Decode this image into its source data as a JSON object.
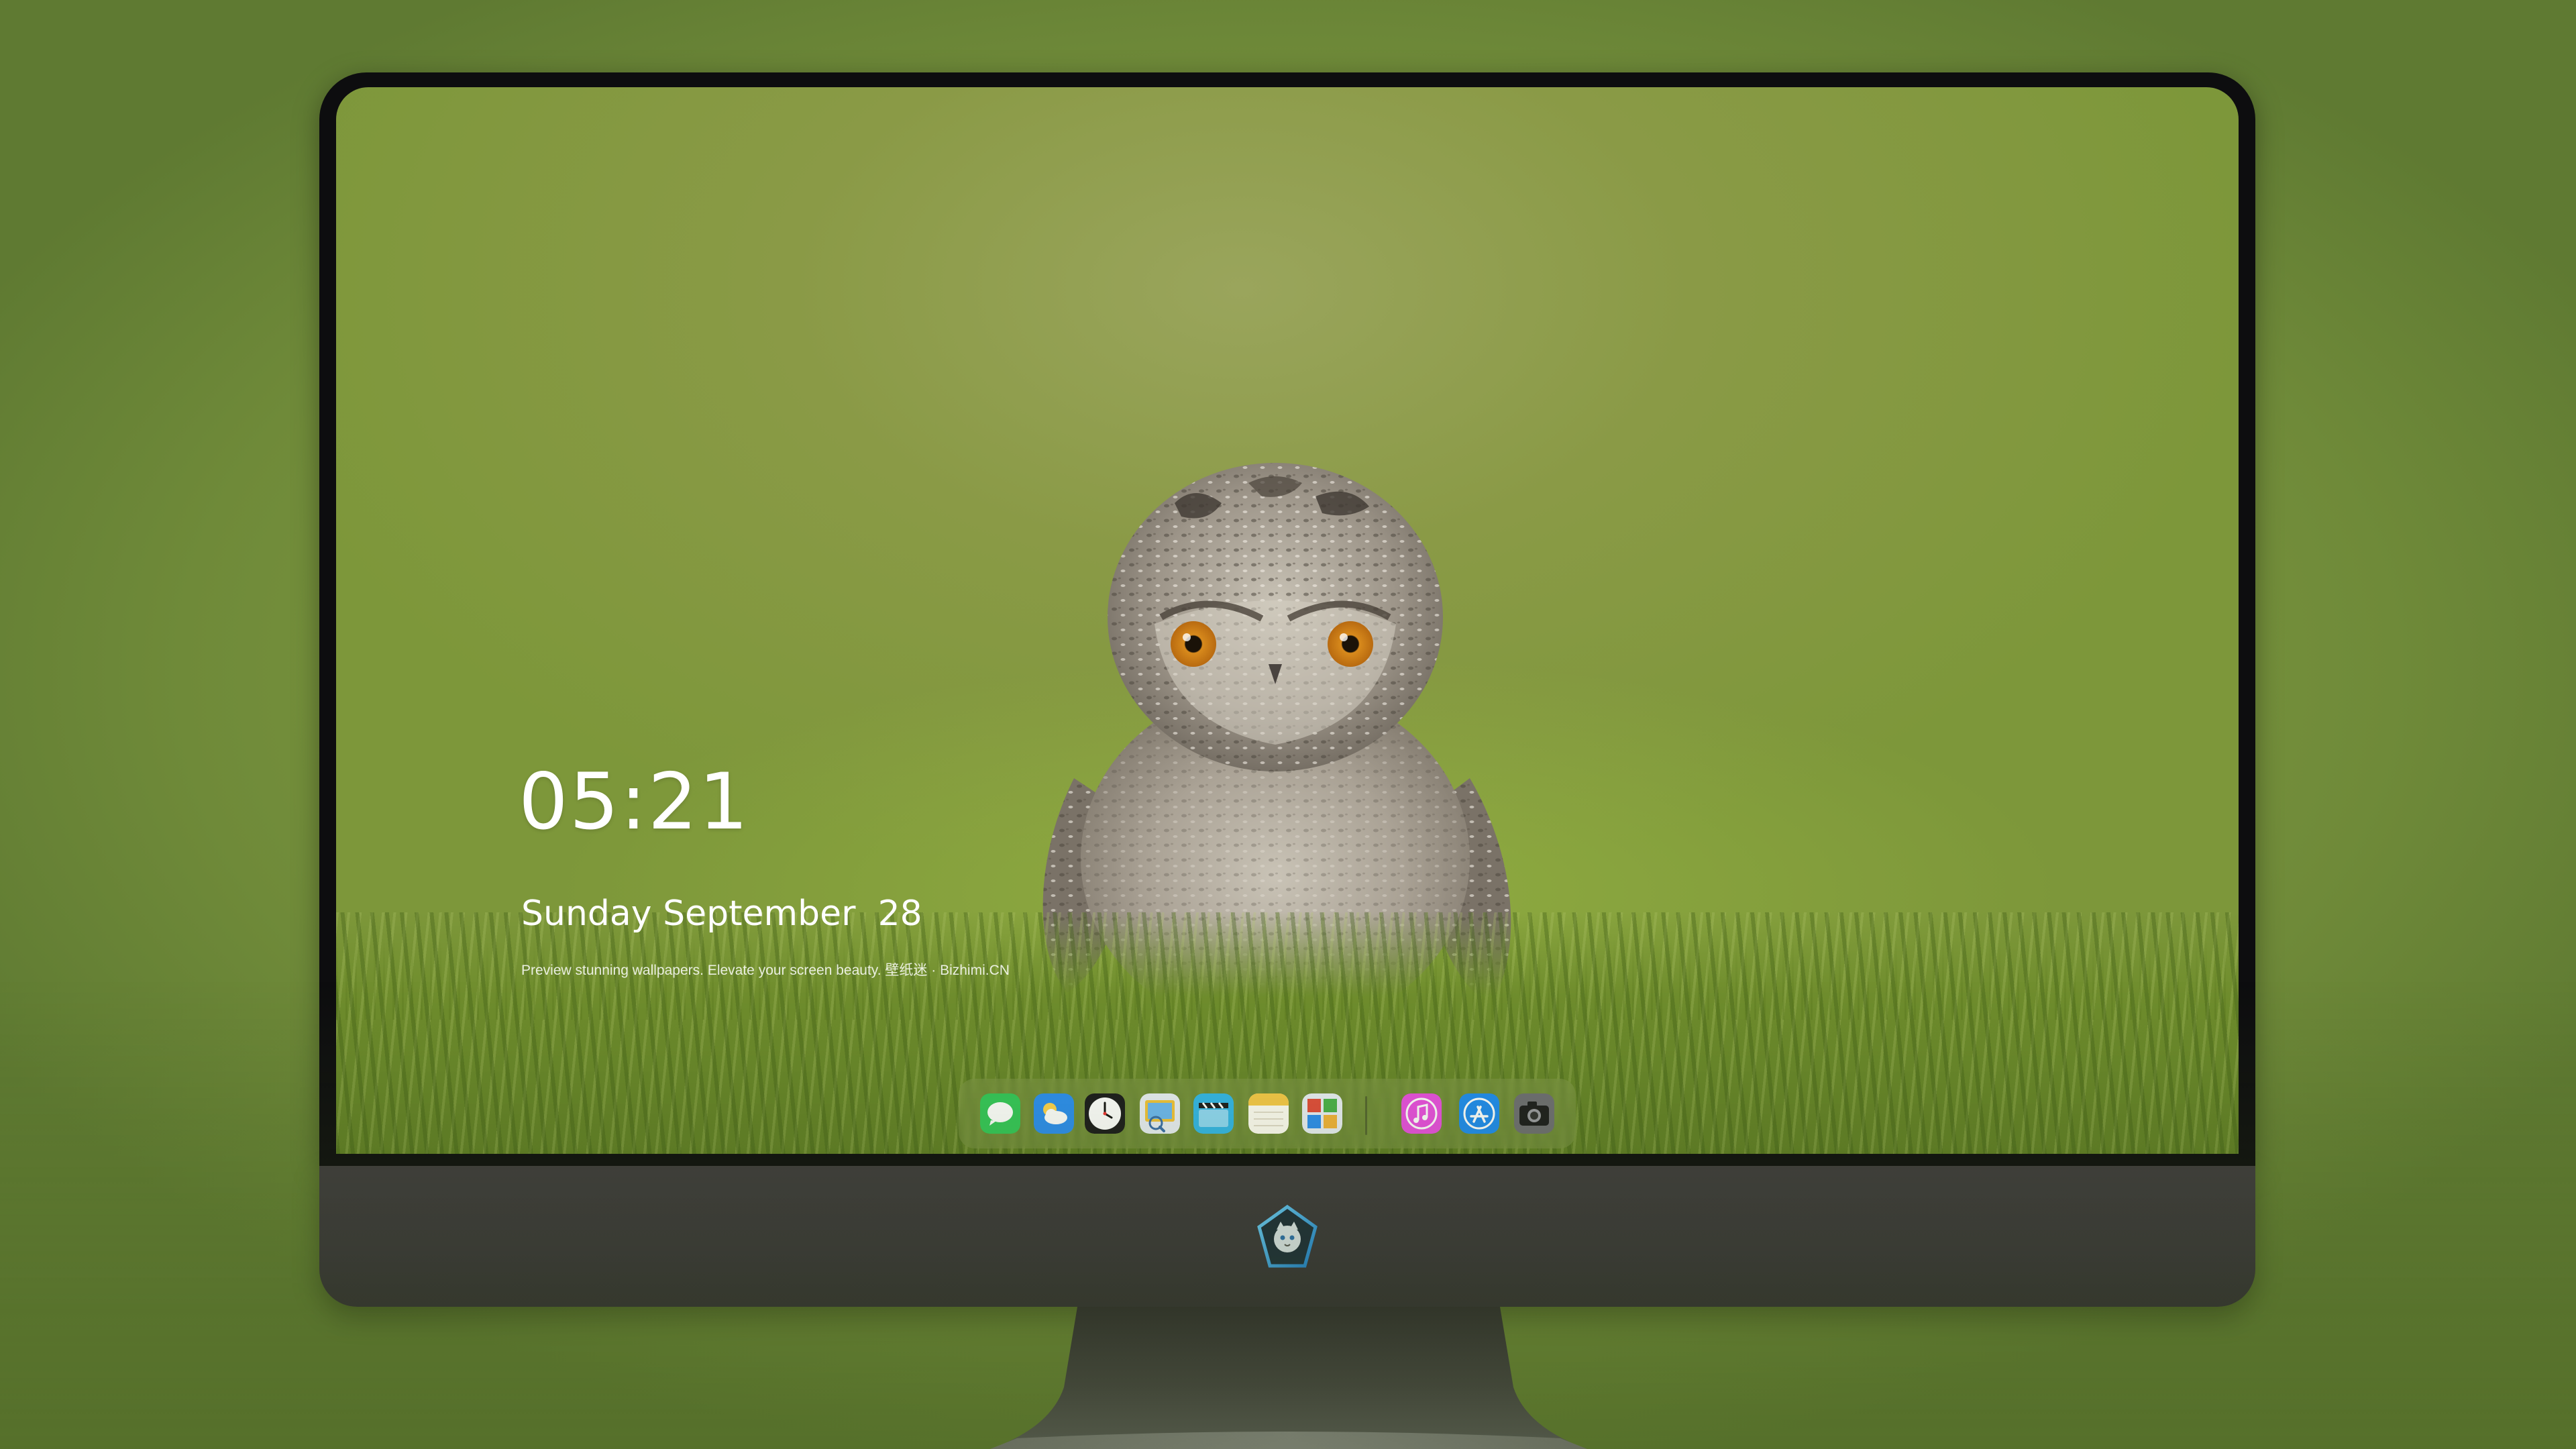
{
  "lockscreen": {
    "time": "05:21",
    "date": "Sunday September  28",
    "caption": "Preview stunning wallpapers. Elevate your screen beauty. 壁纸迷 · Bizhimi.CN"
  },
  "dock": {
    "apps": [
      {
        "name": "Messages",
        "icon": "messages-icon",
        "color": "#34c759"
      },
      {
        "name": "Weather",
        "icon": "weather-icon",
        "color": "#2b8ef0"
      },
      {
        "name": "Clock",
        "icon": "clock-icon",
        "color": "#1b1b1d"
      },
      {
        "name": "Preview",
        "icon": "preview-icon",
        "color": "#f2c33a"
      },
      {
        "name": "Clips",
        "icon": "clapperboard-icon",
        "color": "#33b6e8"
      },
      {
        "name": "Notes",
        "icon": "notes-icon",
        "color": "#f7c948"
      },
      {
        "name": "Photo Booth",
        "icon": "photo-grid-icon",
        "color": "#e24c3b"
      },
      {
        "name": "iTunes",
        "icon": "music-note-icon",
        "color": "#e94fe0"
      },
      {
        "name": "App Store",
        "icon": "app-store-icon",
        "color": "#1f8cf0"
      },
      {
        "name": "Camera",
        "icon": "camera-icon",
        "color": "#6e6e73"
      }
    ]
  },
  "colors": {
    "wallpaper_green": "#7f9a3f",
    "bezel": "#0d0d0f",
    "chin": "#3a363c"
  }
}
